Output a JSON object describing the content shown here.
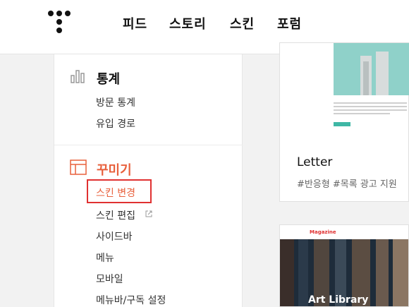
{
  "header": {
    "nav": [
      "피드",
      "스토리",
      "스킨",
      "포럼"
    ]
  },
  "sidebar": {
    "stats": {
      "title": "통계",
      "items": [
        "방문 통계",
        "유입 경로"
      ]
    },
    "decorate": {
      "title": "꾸미기",
      "items": [
        "스킨 변경",
        "스킨 편집",
        "사이드바",
        "메뉴",
        "모바일",
        "메뉴바/구독 설정"
      ]
    }
  },
  "main": {
    "card1": {
      "title": "Letter",
      "tags": "#반응형   #목록 광고 지원"
    },
    "card2": {
      "label": "Magazine",
      "title": "Art Library"
    }
  },
  "colors": {
    "accent": "#e03131",
    "teal": "#3fb7a5"
  }
}
